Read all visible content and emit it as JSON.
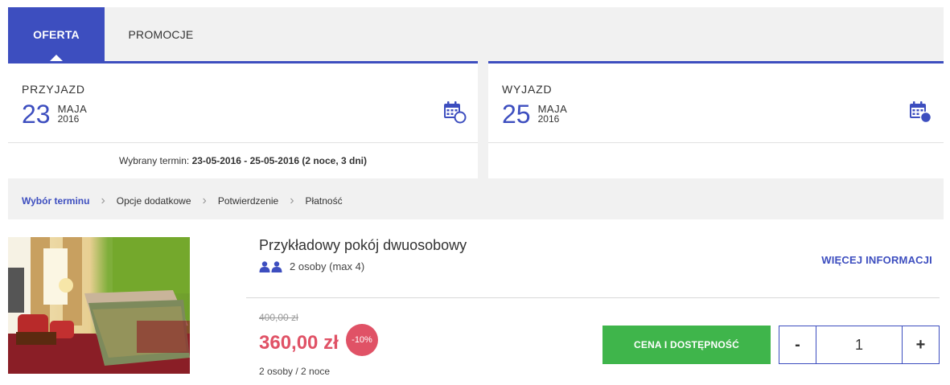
{
  "tabs": [
    {
      "label": "OFERTA",
      "active": true
    },
    {
      "label": "PROMOCJE",
      "active": false
    }
  ],
  "arrival": {
    "label": "PRZYJAZD",
    "day": "23",
    "month": "MAJA",
    "year": "2016",
    "icon": "calendar-arrival-icon"
  },
  "departure": {
    "label": "WYJAZD",
    "day": "25",
    "month": "MAJA",
    "year": "2016",
    "icon": "calendar-departure-icon"
  },
  "selected_term": {
    "prefix": "Wybrany termin: ",
    "value": "23-05-2016 - 25-05-2016 (2 noce, 3 dni)"
  },
  "steps": [
    "Wybór terminu",
    "Opcje dodatkowe",
    "Potwierdzenie",
    "Płatność"
  ],
  "room": {
    "title": "Przykładowy pokój dwuosobowy",
    "guests": "2 osoby (max 4)",
    "more_info": "WIĘCEJ INFORMACJI",
    "old_price": "400,00 zł",
    "new_price": "360,00 zł",
    "discount": "-10%",
    "stay_info": "2 osoby / 2 noce",
    "cta_label": "CENA I DOSTĘPNOŚĆ",
    "quantity": "1",
    "minus_label": "-",
    "plus_label": "+"
  },
  "colors": {
    "accent": "#3d4ebf",
    "price": "#e05266",
    "cta": "#3fb54b",
    "background": "#f1f1f1"
  }
}
